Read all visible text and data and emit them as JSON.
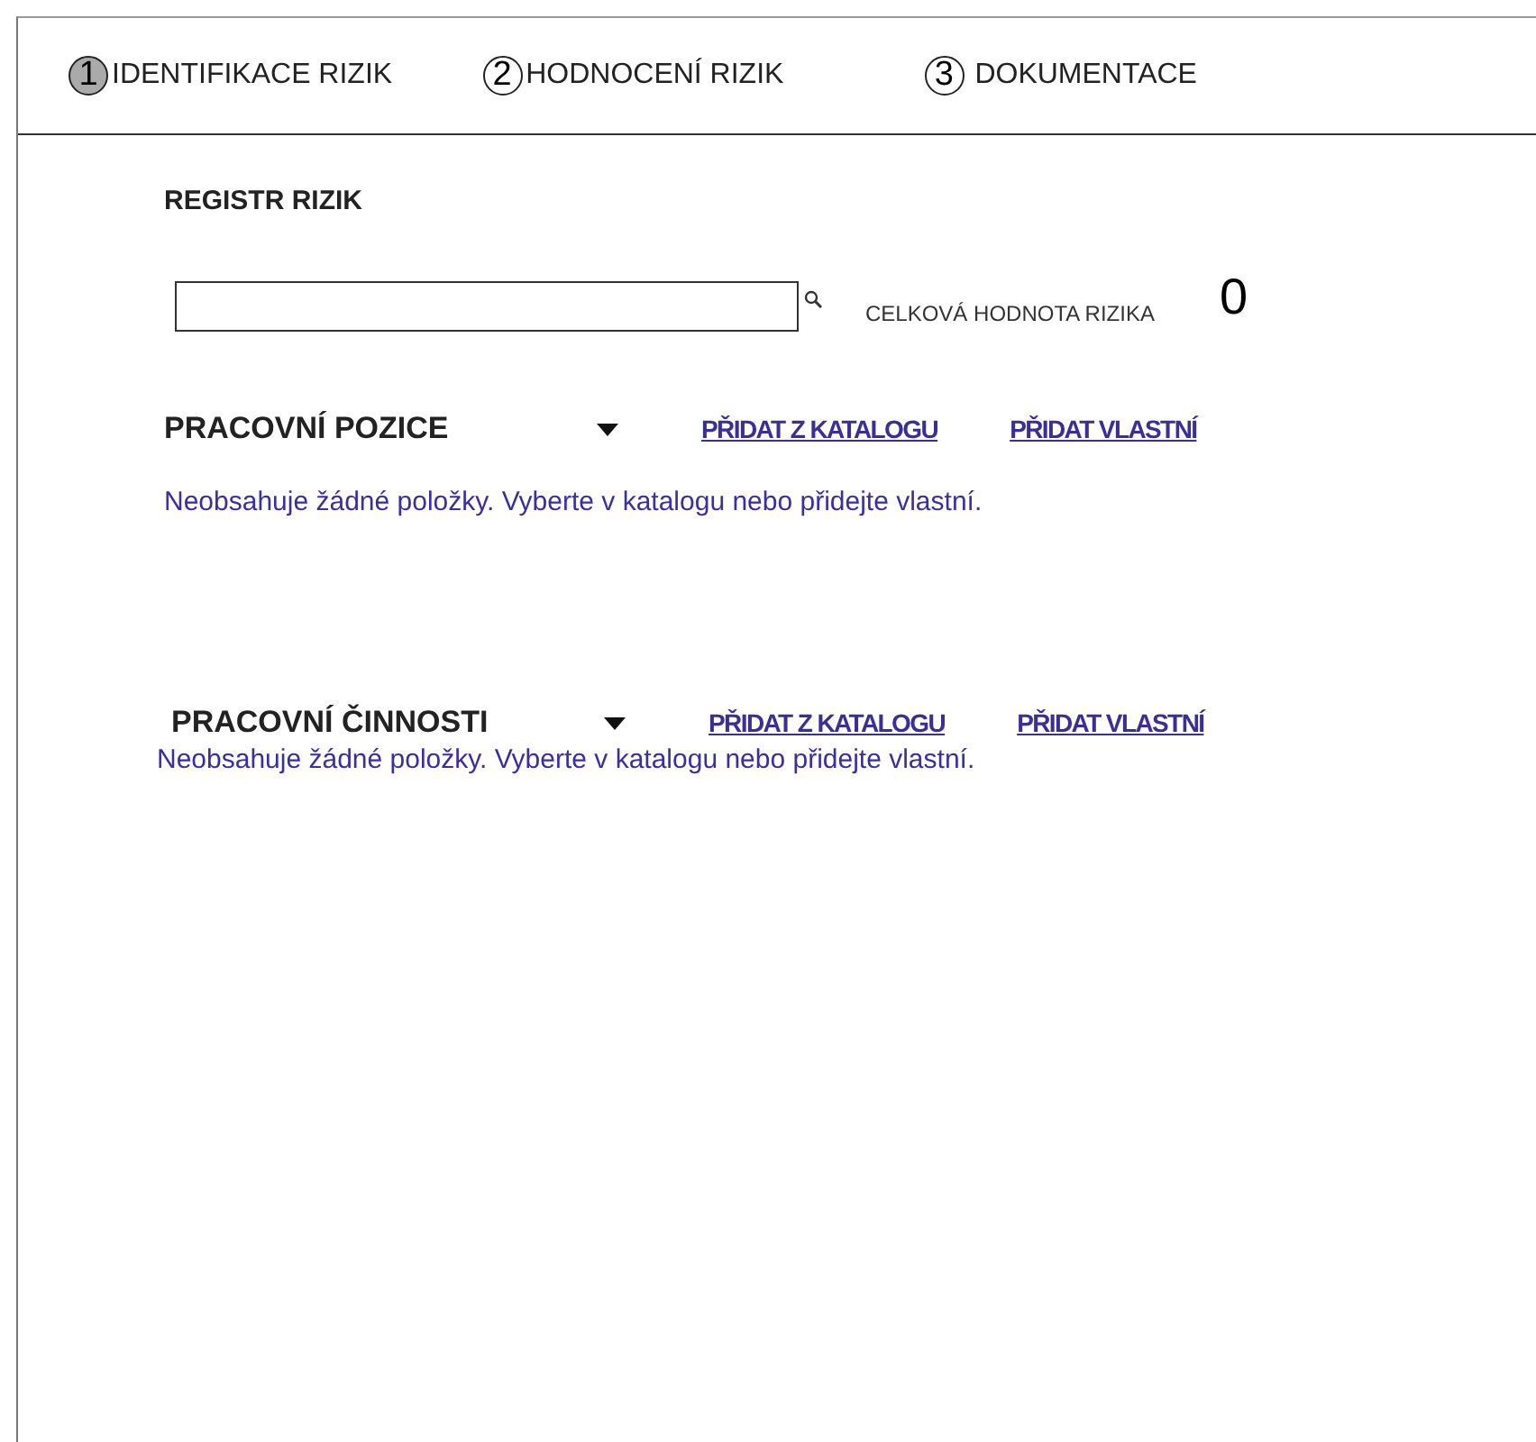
{
  "steps": [
    {
      "number": "1",
      "label": "IDENTIFIKACE RIZIK",
      "selected": true
    },
    {
      "number": "2",
      "label": "HODNOCENÍ RIZIK",
      "selected": false
    },
    {
      "number": "3",
      "label": "DOKUMENTACE",
      "selected": false
    }
  ],
  "title": "REGISTR RIZIK",
  "search": {
    "total_label": "CELKOVÁ HODNOTA RIZIKA",
    "total_value": "0"
  },
  "sections": [
    {
      "title": "PRACOVNÍ POZICE",
      "links": [
        "PŘIDAT Z KATALOGU",
        "PŘIDAT VLASTNÍ"
      ],
      "empty_message": "Neobsahuje žádné položky. Vyberte v katalogu nebo přidejte vlastní."
    },
    {
      "title": "PRACOVNÍ ČINNOSTI",
      "links": [
        "PŘIDAT Z KATALOGU",
        "PŘIDAT VLASTNÍ"
      ],
      "empty_message": "Neobsahuje žádné položky. Vyberte v katalogu nebo přidejte vlastní."
    }
  ]
}
